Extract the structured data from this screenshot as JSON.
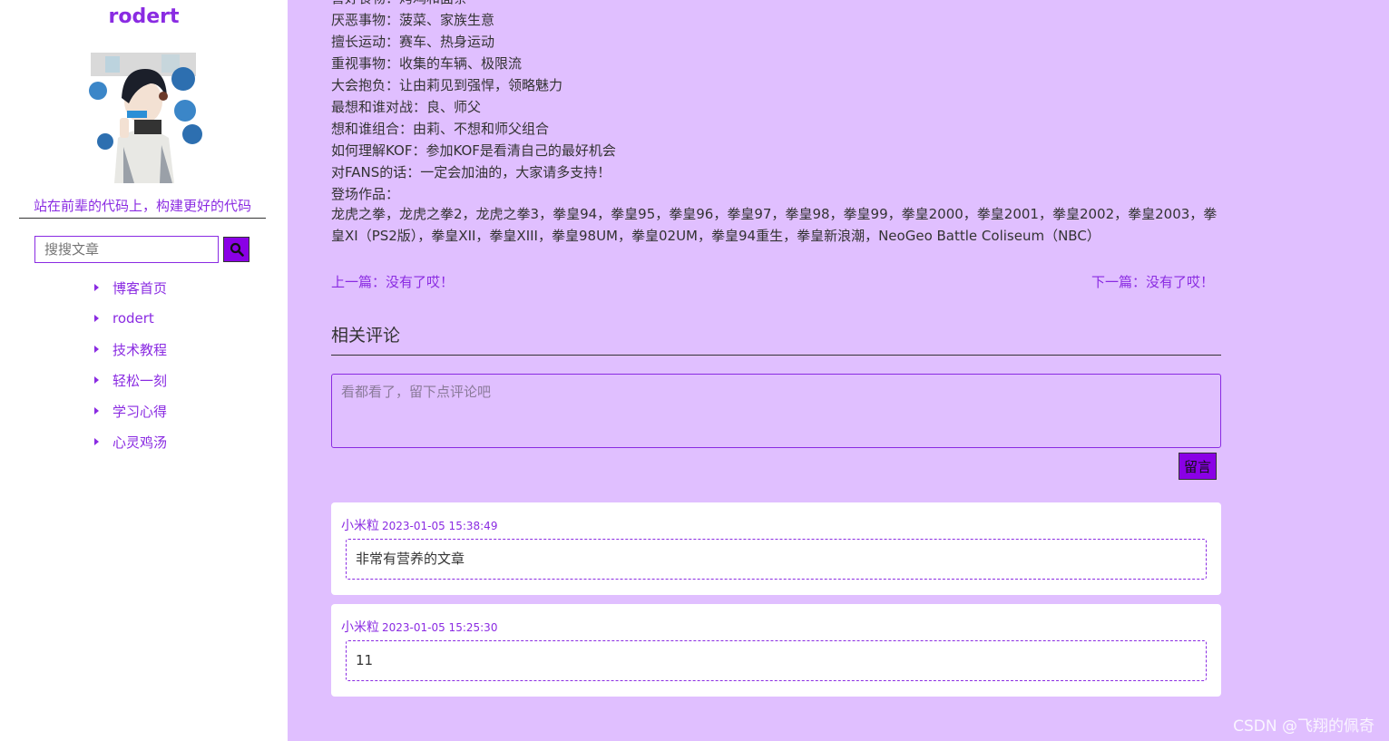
{
  "sidebar": {
    "blog_name": "rodert",
    "slogan": "站在前辈的代码上，构建更好的代码",
    "search": {
      "placeholder": "搜搜文章",
      "value": ""
    },
    "nav_items": [
      {
        "label": "博客首页"
      },
      {
        "label": "rodert"
      },
      {
        "label": "技术教程"
      },
      {
        "label": "轻松一刻"
      },
      {
        "label": "学习心得"
      },
      {
        "label": "心灵鸡汤"
      }
    ]
  },
  "article": {
    "info_lines": [
      "喜好食物：烤鸡和面条",
      "厌恶事物：菠菜、家族生意",
      "擅长运动：赛车、热身运动",
      "重视事物：收集的车辆、极限流",
      "大会抱负：让由莉见到强悍，领略魅力",
      "最想和谁对战：良、师父",
      "想和谁组合：由莉、不想和师父组合",
      "如何理解KOF：参加KOF是看清自己的最好机会",
      "对FANS的话：一定会加油的，大家请多支持！",
      "登场作品："
    ],
    "works": "龙虎之拳，龙虎之拳2，龙虎之拳3，拳皇94，拳皇95，拳皇96，拳皇97，拳皇98，拳皇99，拳皇2000，拳皇2001，拳皇2002，拳皇2003，拳皇XI（PS2版），拳皇XII，拳皇XIII，拳皇98UM，拳皇02UM，拳皇94重生，拳皇新浪潮，NeoGeo Battle Coliseum（NBC）",
    "prev": "上一篇：没有了哎！",
    "next": "下一篇：没有了哎！"
  },
  "comments": {
    "title": "相关评论",
    "input_placeholder": "看都看了，留下点评论吧",
    "submit_label": "留言",
    "items": [
      {
        "user": "小米粒",
        "time": "2023-01-05 15:38:49",
        "text": "非常有营养的文章"
      },
      {
        "user": "小米粒",
        "time": "2023-01-05 15:25:30",
        "text": "11"
      }
    ]
  },
  "watermark": "CSDN @飞翔的佩奇",
  "colors": {
    "accent": "#8a2be2",
    "background": "#e0bfff",
    "button": "#8a00e6"
  },
  "icons": {
    "search": "search-icon",
    "nav_bullet": "caret-right-icon"
  }
}
